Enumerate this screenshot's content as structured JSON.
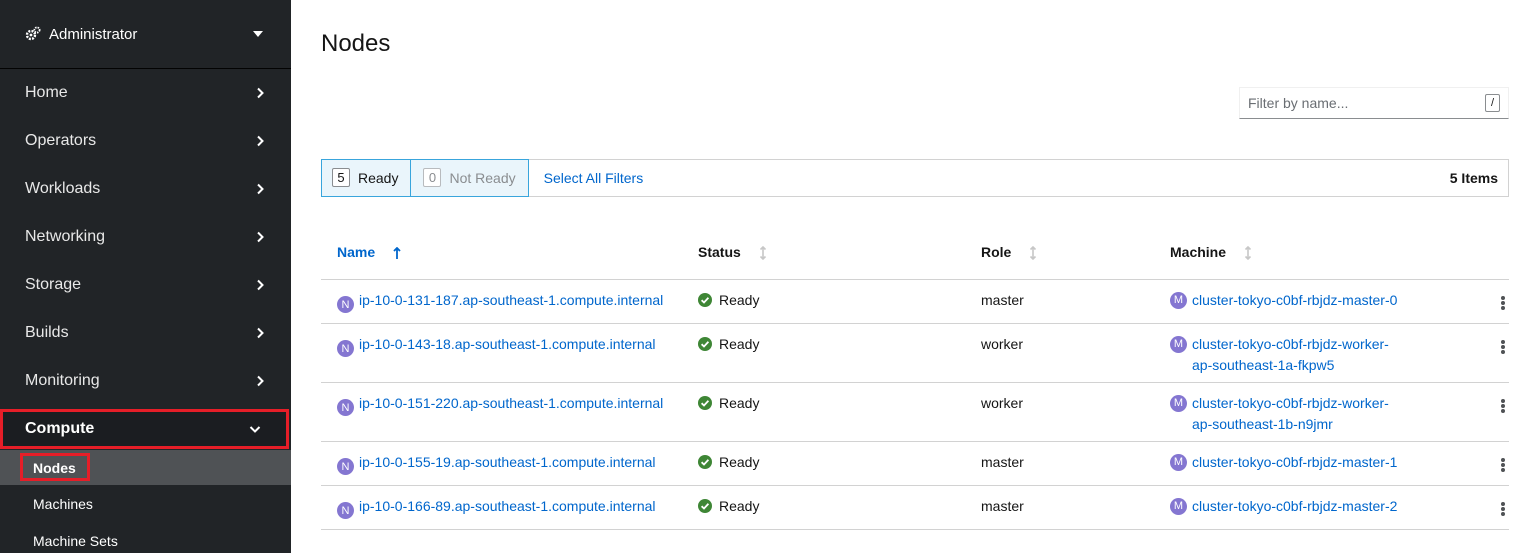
{
  "sidebar": {
    "perspective": "Administrator",
    "items": [
      {
        "label": "Home"
      },
      {
        "label": "Operators"
      },
      {
        "label": "Workloads"
      },
      {
        "label": "Networking"
      },
      {
        "label": "Storage"
      },
      {
        "label": "Builds"
      },
      {
        "label": "Monitoring"
      }
    ],
    "expanded": {
      "label": "Compute",
      "children": [
        {
          "label": "Nodes",
          "active": true
        },
        {
          "label": "Machines"
        },
        {
          "label": "Machine Sets"
        }
      ]
    }
  },
  "page": {
    "title": "Nodes",
    "filter_placeholder": "Filter by name...",
    "filter_shortcut": "/"
  },
  "filters": {
    "ready_count": "5",
    "ready_label": "Ready",
    "notready_count": "0",
    "notready_label": "Not Ready",
    "select_all": "Select All Filters",
    "items": "5 Items"
  },
  "table": {
    "columns": {
      "name": "Name",
      "status": "Status",
      "role": "Role",
      "machine": "Machine"
    },
    "node_badge": "N",
    "machine_badge": "M",
    "rows": [
      {
        "name": "ip-10-0-131-187.ap-southeast-1.compute.internal",
        "status": "Ready",
        "role": "master",
        "machine_1": "cluster-tokyo-c0bf-rbjdz-master-0",
        "machine_2": ""
      },
      {
        "name": "ip-10-0-143-18.ap-southeast-1.compute.internal",
        "status": "Ready",
        "role": "worker",
        "machine_1": "cluster-tokyo-c0bf-rbjdz-worker-",
        "machine_2": "ap-southeast-1a-fkpw5"
      },
      {
        "name": "ip-10-0-151-220.ap-southeast-1.compute.internal",
        "status": "Ready",
        "role": "worker",
        "machine_1": "cluster-tokyo-c0bf-rbjdz-worker-",
        "machine_2": "ap-southeast-1b-n9jmr"
      },
      {
        "name": "ip-10-0-155-19.ap-southeast-1.compute.internal",
        "status": "Ready",
        "role": "master",
        "machine_1": "cluster-tokyo-c0bf-rbjdz-master-1",
        "machine_2": ""
      },
      {
        "name": "ip-10-0-166-89.ap-southeast-1.compute.internal",
        "status": "Ready",
        "role": "master",
        "machine_1": "cluster-tokyo-c0bf-rbjdz-master-2",
        "machine_2": ""
      }
    ]
  },
  "colors": {
    "sidebar_bg": "#212427",
    "link": "#0066cc",
    "highlight": "#e61e28",
    "badge": "#8476d1",
    "ready_check": "#3e8635"
  }
}
